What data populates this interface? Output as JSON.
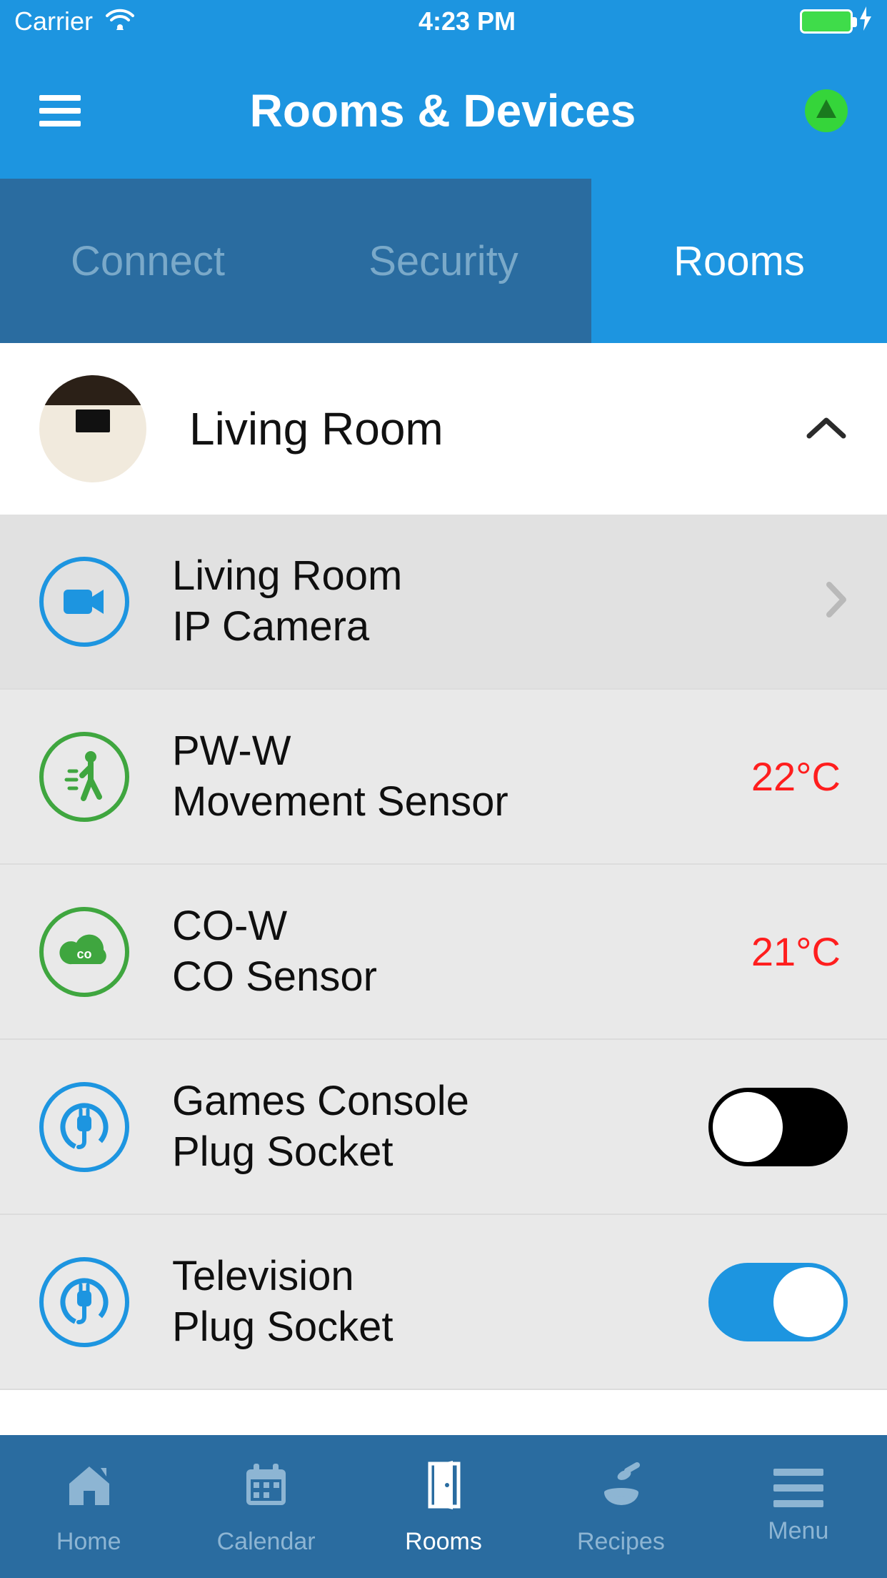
{
  "status_bar": {
    "carrier": "Carrier",
    "time": "4:23 PM"
  },
  "header": {
    "title": "Rooms & Devices"
  },
  "tabs": [
    {
      "label": "Connect",
      "state": "inactive"
    },
    {
      "label": "Security",
      "state": "inactive"
    },
    {
      "label": "Rooms",
      "state": "active"
    }
  ],
  "room": {
    "name": "Living Room",
    "expanded": true
  },
  "devices": [
    {
      "line1": "Living Room",
      "line2": "IP Camera",
      "icon": "camera",
      "ring": "blue",
      "nav": true
    },
    {
      "line1": "PW-W",
      "line2": "Movement Sensor",
      "icon": "motion",
      "ring": "green",
      "temp": "22°C"
    },
    {
      "line1": "CO-W",
      "line2": "CO Sensor",
      "icon": "co",
      "ring": "green",
      "temp": "21°C"
    },
    {
      "line1": "Games Console",
      "line2": "Plug Socket",
      "icon": "plug",
      "ring": "blue",
      "toggle": false
    },
    {
      "line1": "Television",
      "line2": "Plug Socket",
      "icon": "plug",
      "ring": "blue",
      "toggle": true
    }
  ],
  "bottom_tabs": [
    {
      "label": "Home",
      "icon": "home"
    },
    {
      "label": "Calendar",
      "icon": "calendar"
    },
    {
      "label": "Rooms",
      "icon": "door",
      "active": true
    },
    {
      "label": "Recipes",
      "icon": "recipes"
    },
    {
      "label": "Menu",
      "icon": "menu"
    }
  ]
}
